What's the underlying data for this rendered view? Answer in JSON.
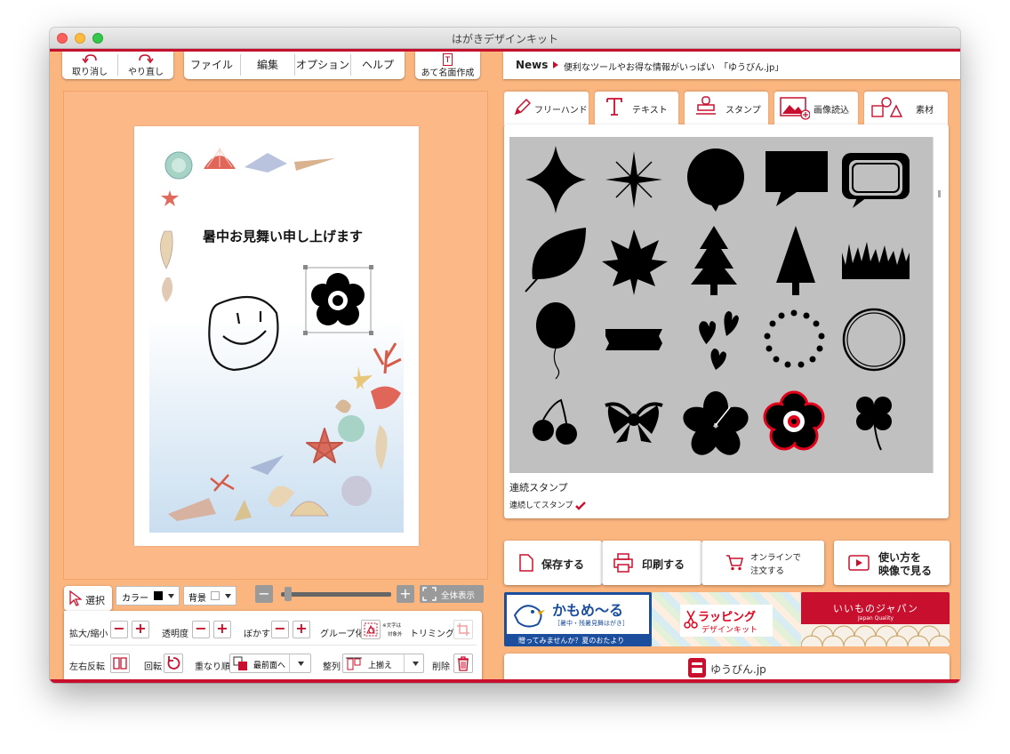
{
  "window": {
    "title": "はがきデザインキット"
  },
  "toolbar": {
    "undo_label": "取り消し",
    "redo_label": "やり直し",
    "menu": [
      "ファイル",
      "編集",
      "オプション",
      "ヘルプ"
    ],
    "address_label": "あて名面作成"
  },
  "news": {
    "label": "News",
    "text": "便利なツールやお得な情報がいっぱい　「ゆうびん.jp」"
  },
  "card": {
    "greeting": "暑中お見舞い申し上げます"
  },
  "tabs": [
    {
      "label": "フリーハンド",
      "icon": "pencil-icon"
    },
    {
      "label": "テキスト",
      "icon": "text-t-icon"
    },
    {
      "label": "スタンプ",
      "icon": "stamp-icon"
    },
    {
      "label": "画像読込",
      "icon": "image-add-icon"
    },
    {
      "label": "素材",
      "icon": "shapes-icon"
    }
  ],
  "stamps": {
    "continuous_title": "連続スタンプ",
    "continuous_check_label": "連続してスタンプ",
    "continuous_checked": true,
    "items": [
      "four-point-star",
      "sparkle",
      "speech-bubble-round",
      "speech-bubble-rect",
      "speech-bubble-double",
      "leaf",
      "maple-leaf",
      "tree-fir",
      "tree-triangle",
      "grass",
      "balloon",
      "tape",
      "hearts",
      "dot-circle",
      "ring",
      "cherries",
      "ribbon",
      "hibiscus",
      "plum-blossom",
      "clover"
    ],
    "selected": "plum-blossom"
  },
  "actions": {
    "save_label": "保存する",
    "print_label": "印刷する",
    "order_line1": "オンラインで",
    "order_line2": "注文する",
    "howto_line1": "使い方を",
    "howto_line2": "映像で見る"
  },
  "banners": {
    "kamome_title": "かもめ〜る",
    "kamome_sub": "［暑中・残暑見舞はがき］",
    "kamome_tagline": "贈ってみませんか？夏のおたより",
    "wrapping_title": "ラッピング",
    "wrapping_sub": "デザインキット",
    "japan_title": "いいものジャパン",
    "japan_sub": "Japan Quality"
  },
  "yubin_label": "ゆうびん.jp",
  "tools": {
    "select_label": "選択",
    "color_label": "カラー",
    "color_value": "#000000",
    "bg_label": "背景",
    "bg_value": "#ffffff",
    "fit_label": "全体表示",
    "scale_label": "拡大/縮小",
    "opacity_label": "透明度",
    "blur_label": "ぼかす",
    "group_label": "グループ化",
    "group_note1": "※文字は",
    "group_note2": "対象外",
    "trim_label": "トリミング",
    "flip_label": "左右反転",
    "rotate_label": "回転",
    "order_label": "重なり順",
    "order_value": "最前面へ",
    "align_label": "整列",
    "align_value": "上揃え",
    "delete_label": "削除"
  },
  "colors": {
    "accent": "#c8102e",
    "panel": "#fbb57e"
  }
}
